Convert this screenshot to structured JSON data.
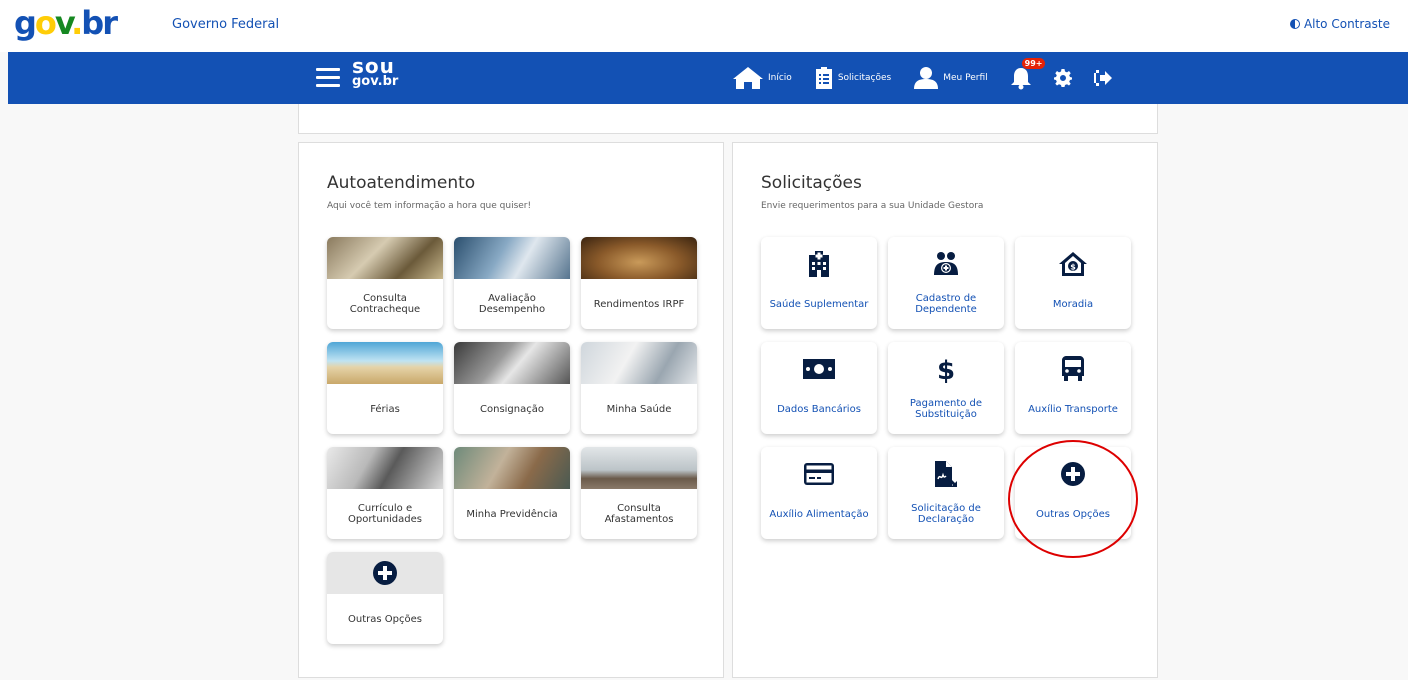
{
  "header": {
    "logo_text": {
      "g": "g",
      "o": "o",
      "v": "v",
      "dot": ".",
      "br": "br"
    },
    "title": "Governo Federal",
    "contrast_label": "Alto Contraste"
  },
  "navbar": {
    "logo_top": "sou",
    "logo_bottom": "gov.br",
    "items": [
      {
        "label": "Início"
      },
      {
        "label": "Solicitações"
      },
      {
        "label": "Meu Perfil"
      }
    ],
    "notification_badge": "99+"
  },
  "autoatendimento": {
    "title": "Autoatendimento",
    "subtitle": "Aqui você tem informação a hora que quiser!",
    "tiles": [
      {
        "label": "Consulta Contracheque"
      },
      {
        "label": "Avaliação Desempenho"
      },
      {
        "label": "Rendimentos IRPF"
      },
      {
        "label": "Férias"
      },
      {
        "label": "Consignação"
      },
      {
        "label": "Minha Saúde"
      },
      {
        "label": "Currículo e Oportunidades"
      },
      {
        "label": "Minha Previdência"
      },
      {
        "label": "Consulta Afastamentos"
      },
      {
        "label": "Outras Opções"
      }
    ]
  },
  "solicitacoes": {
    "title": "Solicitações",
    "subtitle": "Envie requerimentos para a sua Unidade Gestora",
    "tiles": [
      {
        "label": "Saúde Suplementar",
        "icon": "hospital-icon"
      },
      {
        "label": "Cadastro de Dependente",
        "icon": "dependents-icon"
      },
      {
        "label": "Moradia",
        "icon": "house-dollar-icon"
      },
      {
        "label": "Dados Bancários",
        "icon": "money-bill-icon"
      },
      {
        "label": "Pagamento de Substituição",
        "icon": "dollar-icon"
      },
      {
        "label": "Auxílio Transporte",
        "icon": "bus-icon"
      },
      {
        "label": "Auxílio Alimentação",
        "icon": "credit-card-icon"
      },
      {
        "label": "Solicitação de Declaração",
        "icon": "signed-document-icon"
      },
      {
        "label": "Outras Opções",
        "icon": "plus-circle-icon"
      }
    ]
  },
  "colors": {
    "primary": "#1351b4",
    "icon_dark": "#071d41",
    "highlight": "#dd0000"
  }
}
